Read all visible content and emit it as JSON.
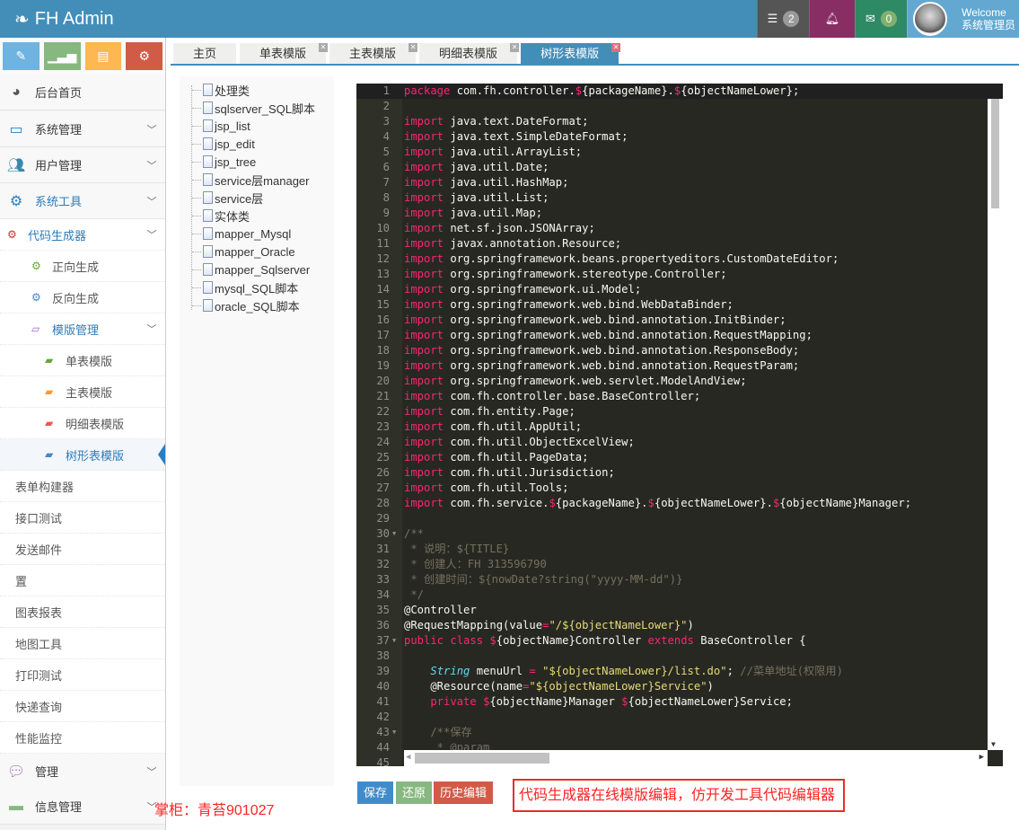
{
  "header": {
    "brand": "FH Admin",
    "tasks_count": "2",
    "messages_count": "0",
    "welcome": "Welcome",
    "user": "系统管理员",
    "colors": {
      "bar": "#438eb9",
      "tasks": "#555555",
      "notify": "#892e65",
      "messages": "#2e8965",
      "user": "#62a8d1"
    }
  },
  "shortcuts": [
    {
      "icon": "pencil-icon",
      "color": "#6fb3e0"
    },
    {
      "icon": "signal-icon",
      "color": "#87b87f"
    },
    {
      "icon": "book-icon",
      "color": "#ffb752"
    },
    {
      "icon": "cogs-icon",
      "color": "#d15b47"
    }
  ],
  "sidebar": {
    "top": [
      {
        "label": "后台首页",
        "icon": "dashboard-icon"
      },
      {
        "label": "系统管理",
        "icon": "desktop-icon"
      },
      {
        "label": "用户管理",
        "icon": "users-icon"
      },
      {
        "label": "系统工具",
        "icon": "cog-icon"
      }
    ],
    "tools": [
      {
        "label": "代码生成器"
      },
      {
        "label": "正向生成"
      },
      {
        "label": "反向生成"
      },
      {
        "label": "模版管理"
      },
      {
        "label": "单表模版"
      },
      {
        "label": "主表模版"
      },
      {
        "label": "明细表模版"
      },
      {
        "label": "树形表模版",
        "active": true
      },
      {
        "label": "表单构建器"
      },
      {
        "label": "接口测试"
      },
      {
        "label": "发送邮件"
      },
      {
        "label": "置"
      },
      {
        "label": "图表报表"
      },
      {
        "label": "地图工具"
      },
      {
        "label": "打印测试"
      },
      {
        "label": "快递查询"
      },
      {
        "label": "性能监控"
      }
    ],
    "bottom": [
      {
        "label": "管理",
        "icon": "comments-icon"
      },
      {
        "label": "信息管理",
        "icon": "credit-card-icon"
      }
    ]
  },
  "tabs": [
    {
      "label": "主页"
    },
    {
      "label": "单表模版"
    },
    {
      "label": "主表模版"
    },
    {
      "label": "明细表模版"
    },
    {
      "label": "树形表模版",
      "active": true
    }
  ],
  "tree": [
    "处理类",
    "sqlserver_SQL脚本",
    "jsp_list",
    "jsp_edit",
    "jsp_tree",
    "service层manager",
    "service层",
    "实体类",
    "mapper_Mysql",
    "mapper_Oracle",
    "mapper_Sqlserver",
    "mysql_SQL脚本",
    "oracle_SQL脚本"
  ],
  "editor": {
    "theme": "monokai",
    "lines": [
      "package com.fh.controller.${packageName}.${objectNameLower};",
      "",
      "import java.text.DateFormat;",
      "import java.text.SimpleDateFormat;",
      "import java.util.ArrayList;",
      "import java.util.Date;",
      "import java.util.HashMap;",
      "import java.util.List;",
      "import java.util.Map;",
      "import net.sf.json.JSONArray;",
      "import javax.annotation.Resource;",
      "import org.springframework.beans.propertyeditors.CustomDateEditor;",
      "import org.springframework.stereotype.Controller;",
      "import org.springframework.ui.Model;",
      "import org.springframework.web.bind.WebDataBinder;",
      "import org.springframework.web.bind.annotation.InitBinder;",
      "import org.springframework.web.bind.annotation.RequestMapping;",
      "import org.springframework.web.bind.annotation.ResponseBody;",
      "import org.springframework.web.bind.annotation.RequestParam;",
      "import org.springframework.web.servlet.ModelAndView;",
      "import com.fh.controller.base.BaseController;",
      "import com.fh.entity.Page;",
      "import com.fh.util.AppUtil;",
      "import com.fh.util.ObjectExcelView;",
      "import com.fh.util.PageData;",
      "import com.fh.util.Jurisdiction;",
      "import com.fh.util.Tools;",
      "import com.fh.service.${packageName}.${objectNameLower}.${objectName}Manager;",
      "",
      "/**",
      " * 说明：${TITLE}",
      " * 创建人：FH 313596790",
      " * 创建时间：${nowDate?string(\"yyyy-MM-dd\")}",
      " */",
      "@Controller",
      "@RequestMapping(value=\"/${objectNameLower}\")",
      "public class ${objectName}Controller extends BaseController {",
      "",
      "    String menuUrl = \"${objectNameLower}/list.do\"; //菜单地址(权限用)",
      "    @Resource(name=\"${objectNameLower}Service\")",
      "    private ${objectName}Manager ${objectNameLower}Service;",
      "",
      "    /**保存",
      "     * @param",
      ""
    ],
    "folds": [
      30,
      37,
      43
    ],
    "comment_lines": [
      30,
      31,
      32,
      33,
      34,
      43,
      44
    ]
  },
  "buttons": {
    "save": "保存",
    "restore": "还原",
    "history": "历史编辑"
  },
  "annotation": "代码生成器在线模版编辑，仿开发工具代码编辑器",
  "watermark": "掌柜：青苔901027"
}
